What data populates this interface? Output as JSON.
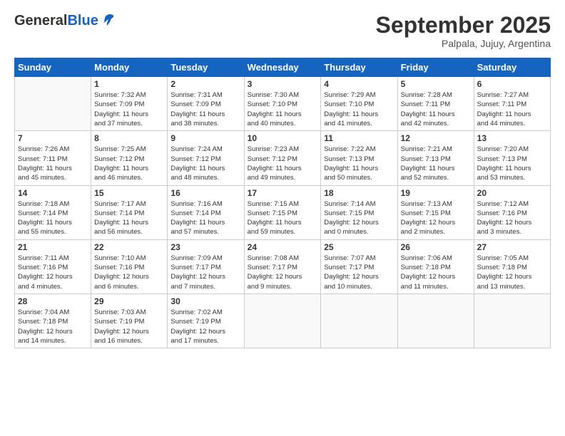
{
  "header": {
    "logo_general": "General",
    "logo_blue": "Blue",
    "month_year": "September 2025",
    "location": "Palpala, Jujuy, Argentina"
  },
  "days_of_week": [
    "Sunday",
    "Monday",
    "Tuesday",
    "Wednesday",
    "Thursday",
    "Friday",
    "Saturday"
  ],
  "weeks": [
    [
      {
        "day": "",
        "info": ""
      },
      {
        "day": "1",
        "info": "Sunrise: 7:32 AM\nSunset: 7:09 PM\nDaylight: 11 hours\nand 37 minutes."
      },
      {
        "day": "2",
        "info": "Sunrise: 7:31 AM\nSunset: 7:09 PM\nDaylight: 11 hours\nand 38 minutes."
      },
      {
        "day": "3",
        "info": "Sunrise: 7:30 AM\nSunset: 7:10 PM\nDaylight: 11 hours\nand 40 minutes."
      },
      {
        "day": "4",
        "info": "Sunrise: 7:29 AM\nSunset: 7:10 PM\nDaylight: 11 hours\nand 41 minutes."
      },
      {
        "day": "5",
        "info": "Sunrise: 7:28 AM\nSunset: 7:11 PM\nDaylight: 11 hours\nand 42 minutes."
      },
      {
        "day": "6",
        "info": "Sunrise: 7:27 AM\nSunset: 7:11 PM\nDaylight: 11 hours\nand 44 minutes."
      }
    ],
    [
      {
        "day": "7",
        "info": "Sunrise: 7:26 AM\nSunset: 7:11 PM\nDaylight: 11 hours\nand 45 minutes."
      },
      {
        "day": "8",
        "info": "Sunrise: 7:25 AM\nSunset: 7:12 PM\nDaylight: 11 hours\nand 46 minutes."
      },
      {
        "day": "9",
        "info": "Sunrise: 7:24 AM\nSunset: 7:12 PM\nDaylight: 11 hours\nand 48 minutes."
      },
      {
        "day": "10",
        "info": "Sunrise: 7:23 AM\nSunset: 7:12 PM\nDaylight: 11 hours\nand 49 minutes."
      },
      {
        "day": "11",
        "info": "Sunrise: 7:22 AM\nSunset: 7:13 PM\nDaylight: 11 hours\nand 50 minutes."
      },
      {
        "day": "12",
        "info": "Sunrise: 7:21 AM\nSunset: 7:13 PM\nDaylight: 11 hours\nand 52 minutes."
      },
      {
        "day": "13",
        "info": "Sunrise: 7:20 AM\nSunset: 7:13 PM\nDaylight: 11 hours\nand 53 minutes."
      }
    ],
    [
      {
        "day": "14",
        "info": "Sunrise: 7:18 AM\nSunset: 7:14 PM\nDaylight: 11 hours\nand 55 minutes."
      },
      {
        "day": "15",
        "info": "Sunrise: 7:17 AM\nSunset: 7:14 PM\nDaylight: 11 hours\nand 56 minutes."
      },
      {
        "day": "16",
        "info": "Sunrise: 7:16 AM\nSunset: 7:14 PM\nDaylight: 11 hours\nand 57 minutes."
      },
      {
        "day": "17",
        "info": "Sunrise: 7:15 AM\nSunset: 7:15 PM\nDaylight: 11 hours\nand 59 minutes."
      },
      {
        "day": "18",
        "info": "Sunrise: 7:14 AM\nSunset: 7:15 PM\nDaylight: 12 hours\nand 0 minutes."
      },
      {
        "day": "19",
        "info": "Sunrise: 7:13 AM\nSunset: 7:15 PM\nDaylight: 12 hours\nand 2 minutes."
      },
      {
        "day": "20",
        "info": "Sunrise: 7:12 AM\nSunset: 7:16 PM\nDaylight: 12 hours\nand 3 minutes."
      }
    ],
    [
      {
        "day": "21",
        "info": "Sunrise: 7:11 AM\nSunset: 7:16 PM\nDaylight: 12 hours\nand 4 minutes."
      },
      {
        "day": "22",
        "info": "Sunrise: 7:10 AM\nSunset: 7:16 PM\nDaylight: 12 hours\nand 6 minutes."
      },
      {
        "day": "23",
        "info": "Sunrise: 7:09 AM\nSunset: 7:17 PM\nDaylight: 12 hours\nand 7 minutes."
      },
      {
        "day": "24",
        "info": "Sunrise: 7:08 AM\nSunset: 7:17 PM\nDaylight: 12 hours\nand 9 minutes."
      },
      {
        "day": "25",
        "info": "Sunrise: 7:07 AM\nSunset: 7:17 PM\nDaylight: 12 hours\nand 10 minutes."
      },
      {
        "day": "26",
        "info": "Sunrise: 7:06 AM\nSunset: 7:18 PM\nDaylight: 12 hours\nand 11 minutes."
      },
      {
        "day": "27",
        "info": "Sunrise: 7:05 AM\nSunset: 7:18 PM\nDaylight: 12 hours\nand 13 minutes."
      }
    ],
    [
      {
        "day": "28",
        "info": "Sunrise: 7:04 AM\nSunset: 7:18 PM\nDaylight: 12 hours\nand 14 minutes."
      },
      {
        "day": "29",
        "info": "Sunrise: 7:03 AM\nSunset: 7:19 PM\nDaylight: 12 hours\nand 16 minutes."
      },
      {
        "day": "30",
        "info": "Sunrise: 7:02 AM\nSunset: 7:19 PM\nDaylight: 12 hours\nand 17 minutes."
      },
      {
        "day": "",
        "info": ""
      },
      {
        "day": "",
        "info": ""
      },
      {
        "day": "",
        "info": ""
      },
      {
        "day": "",
        "info": ""
      }
    ]
  ]
}
